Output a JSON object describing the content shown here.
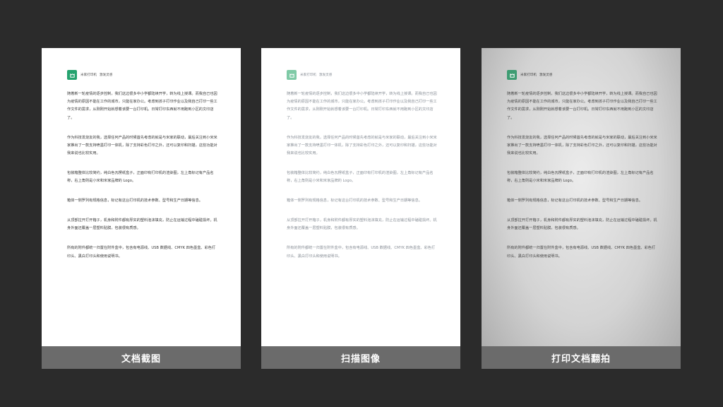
{
  "header": {
    "brand": "米家打印机",
    "tagline": "激发灵感"
  },
  "paragraphs": [
    "随着新一轮疫情的逐步控制，我们这边很多中小学都陆续开学，转为线上授课。而我自己也因为疫情的原因不能在工作的城市，只能在家办公。考虑到孩子打印作业以及我自己打印一些工作文件的需求，从刚刚开始就想着该要一台打印机。日常打印东西就不用跑到小区的文印店了。",
    "作为科技发烧友的我，选择任何产品的时候首先考虑的就是与米家的联动，最后关注到小米米家推出了一款支持喷墨打印一体机，除了支持彩色打印之外，还可以复印和扫描，这些功能对我来说也比较实用。",
    "包装箱整体比较简约，纯白色瓦楞纸盒子，正面印有打印机的渲染图，左上角标记有产品名称，右上角则是小米和米家品牌的 Logo。",
    "箱体一侧罗列有规格信息，标记有这台打印机的技术参数、型号和生产日期等信息。",
    "从顶部拉开打开箱子，机身和附件都有厚实的塑料泡沫填充，防止在运输过程中磕碰损坏。机身外面还覆盖一层塑料贴膜，包装很有质感。",
    "所有的附件都统一归置在附件盒中，包含有电源线、USB 数据线、CMYK 四色墨盒、彩色打印头、黑白打印头和使用说明书。"
  ],
  "captions": [
    "文档截图",
    "扫描图像",
    "打印文档翻拍"
  ],
  "colors": {
    "logo": "#25a36f",
    "caption_bar": "#6b6b6b",
    "background": "#2b2b2b"
  }
}
